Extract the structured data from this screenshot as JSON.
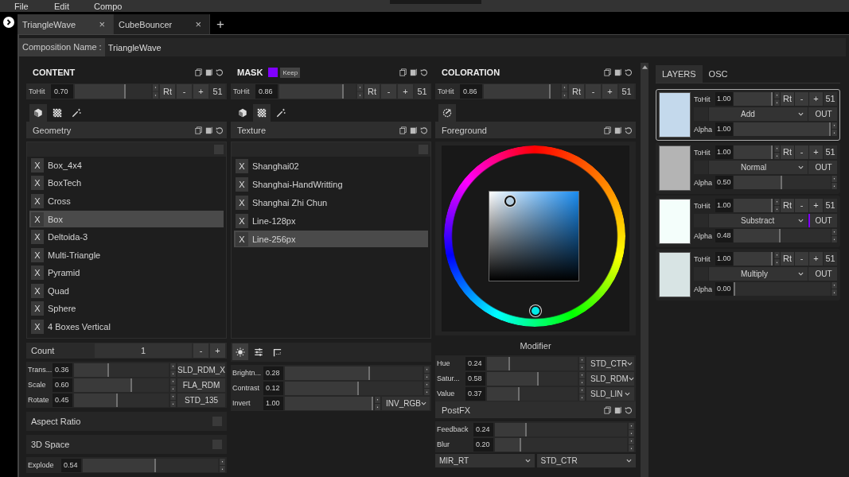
{
  "menu": [
    {
      "label": "File"
    },
    {
      "label": "Edit"
    },
    {
      "label": "Compo"
    }
  ],
  "doc_tabs": [
    {
      "label": "TriangleWave",
      "close": "×",
      "selected": true
    },
    {
      "label": "CubeBouncer",
      "close": "×",
      "selected": false
    }
  ],
  "new_tab": "+",
  "composition": {
    "label": "Composition Name :",
    "value": "TriangleWave"
  },
  "content": {
    "title": "CONTENT",
    "tohit": {
      "label": "ToHit",
      "value": "0.70",
      "level": 0.67,
      "rt": "Rt",
      "minus": "-",
      "plus": "+",
      "count": "51"
    },
    "sub_tabs": [
      {
        "kind": "cube",
        "selected": true
      },
      {
        "kind": "checker",
        "selected": false
      },
      {
        "kind": "wand",
        "selected": false
      }
    ],
    "section": "Geometry",
    "select_all": false,
    "items": [
      {
        "remove": "X",
        "label": "Box_4x4",
        "selected": false
      },
      {
        "remove": "X",
        "label": "BoxTech",
        "selected": false
      },
      {
        "remove": "X",
        "label": "Cross",
        "selected": false
      },
      {
        "remove": "X",
        "label": "Box",
        "selected": true
      },
      {
        "remove": "X",
        "label": "Deltoida-3",
        "selected": false
      },
      {
        "remove": "X",
        "label": "Multi-Triangle",
        "selected": false
      },
      {
        "remove": "X",
        "label": "Pyramid",
        "selected": false
      },
      {
        "remove": "X",
        "label": "Quad",
        "selected": false
      },
      {
        "remove": "X",
        "label": "Sphere",
        "selected": false
      },
      {
        "remove": "X",
        "label": "4 Boxes Vertical",
        "selected": false
      }
    ],
    "count": {
      "label": "Count",
      "value": "1",
      "minus": "-",
      "plus": "+"
    },
    "params": [
      {
        "label": "Trans...",
        "value": "0.36",
        "level": 0.37,
        "kind": "plain",
        "mode": "SLD_RDM_X"
      },
      {
        "label": "Scale",
        "value": "0.60",
        "level": 0.61,
        "kind": "plain",
        "mode": "FLA_RDM"
      },
      {
        "label": "Rotate",
        "value": "0.45",
        "level": 0.46,
        "kind": "plain",
        "mode": "STD_135"
      }
    ],
    "toggles": [
      {
        "label": "Aspect Ratio",
        "checked": false
      },
      {
        "label": "3D Space",
        "checked": false
      }
    ],
    "explode": [
      {
        "label": "Explode",
        "value": "0.54",
        "level": 0.54
      }
    ]
  },
  "mask": {
    "title": "MASK",
    "color": "#8000ff",
    "keep": "Keep",
    "tohit": {
      "label": "ToHit",
      "value": "0.86",
      "level": 0.84,
      "rt": "Rt",
      "minus": "-",
      "plus": "+",
      "count": "51"
    },
    "sub_tabs": [
      {
        "kind": "cube",
        "selected": false
      },
      {
        "kind": "checker",
        "selected": true
      },
      {
        "kind": "wand",
        "selected": false
      }
    ],
    "section": "Texture",
    "select_all": false,
    "items": [
      {
        "remove": "X",
        "label": "Shanghai02",
        "selected": false
      },
      {
        "remove": "X",
        "label": "Shanghai-HandWritting",
        "selected": false
      },
      {
        "remove": "X",
        "label": "Shanghai Zhi Chun",
        "selected": false
      },
      {
        "remove": "X",
        "label": "Line-128px",
        "selected": false
      },
      {
        "remove": "X",
        "label": "Line-256px",
        "selected": true
      }
    ],
    "adjust_tabs": [
      {
        "kind": "sun",
        "selected": true
      },
      {
        "kind": "sliders",
        "selected": false
      },
      {
        "kind": "crop",
        "selected": false
      }
    ],
    "params": [
      {
        "label": "Brightn...",
        "value": "0.28",
        "level": 0.62,
        "kind": "none"
      },
      {
        "label": "Contrast",
        "value": "0.12",
        "level": 0.54,
        "kind": "none"
      },
      {
        "label": "Invert",
        "value": "1.00",
        "level": 1.0,
        "kind": "select",
        "mode": "INV_RGB"
      }
    ]
  },
  "coloration": {
    "title": "COLORATION",
    "tohit": {
      "label": "ToHit",
      "value": "0.86",
      "level": 0.87,
      "rt": "Rt",
      "minus": "-",
      "plus": "+",
      "count": "51"
    },
    "sub_tabs": [
      {
        "kind": "palette",
        "selected": true
      }
    ],
    "section": "Foreground",
    "modifier": "Modifier",
    "params": [
      {
        "label": "Hue",
        "value": "0.24",
        "level": 0.25,
        "kind": "select",
        "mode": "STD_CTR"
      },
      {
        "label": "Satur...",
        "value": "0.58",
        "level": 0.57,
        "kind": "select",
        "mode": "SLD_RDM"
      },
      {
        "label": "Value",
        "value": "0.37",
        "level": 0.36,
        "kind": "select",
        "mode": "SLD_LIN"
      }
    ],
    "postfx": {
      "title": "PostFX",
      "params": [
        {
          "label": "Feedback",
          "value": "0.24",
          "level": 0.24
        },
        {
          "label": "Blur",
          "value": "0.20",
          "level": 0.2
        }
      ],
      "selects": [
        "MIR_RT",
        "STD_CTR"
      ]
    }
  },
  "layer_tabs": [
    {
      "label": "LAYERS",
      "selected": true
    },
    {
      "label": "OSC",
      "selected": false
    }
  ],
  "layers": [
    {
      "color": "#c4d9ec",
      "selected": true,
      "tohit": {
        "label": "ToHit",
        "value": "1.00",
        "level": 0.97,
        "rt": "Rt",
        "minus": "-",
        "plus": "+",
        "count": "51"
      },
      "blend": "Add",
      "out": "OUT",
      "out_active": false,
      "alpha": {
        "label": "Alpha",
        "value": "1.00",
        "level": 1.0
      }
    },
    {
      "color": "#b4b4b4",
      "selected": false,
      "tohit": {
        "label": "ToHit",
        "value": "1.00",
        "level": 0.97,
        "rt": "Rt",
        "minus": "-",
        "plus": "+",
        "count": "51"
      },
      "blend": "Normal",
      "out": "OUT",
      "out_active": false,
      "alpha": {
        "label": "Alpha",
        "value": "0.50",
        "level": 0.5
      }
    },
    {
      "color": "#f4fefb",
      "selected": false,
      "tohit": {
        "label": "ToHit",
        "value": "1.00",
        "level": 0.97,
        "rt": "Rt",
        "minus": "-",
        "plus": "+",
        "count": "51"
      },
      "blend": "Substract",
      "out": "OUT",
      "out_active": true,
      "alpha": {
        "label": "Alpha",
        "value": "0.48",
        "level": 0.48
      }
    },
    {
      "color": "#d8e4e4",
      "selected": false,
      "tohit": {
        "label": "ToHit",
        "value": "1.00",
        "level": 0.97,
        "rt": "Rt",
        "minus": "-",
        "plus": "+",
        "count": "51"
      },
      "blend": "Multiply",
      "out": "OUT",
      "out_active": false,
      "alpha": {
        "label": "Alpha",
        "value": "0.00",
        "level": 0.0
      }
    }
  ]
}
